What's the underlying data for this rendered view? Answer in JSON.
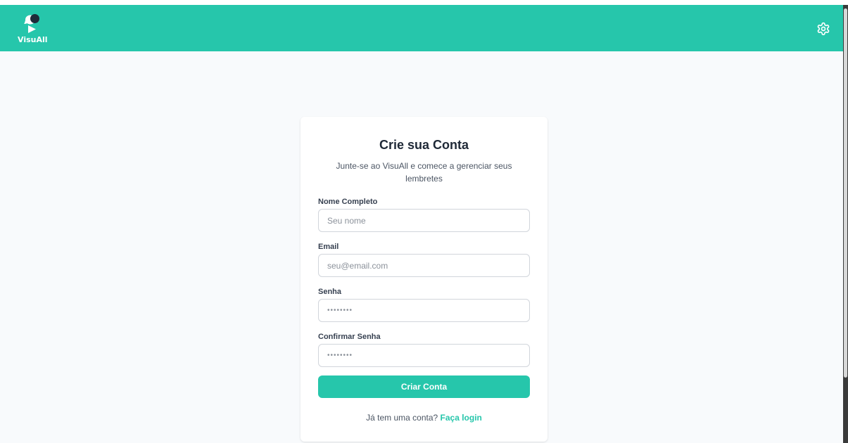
{
  "app": {
    "logo_text": "VisuAll",
    "logo_icon": "chat-play-icon",
    "settings_icon": "gear-icon"
  },
  "colors": {
    "brand": "#26c6ab",
    "background": "#f8fafc",
    "card": "#ffffff",
    "title": "#1f2937"
  },
  "signup": {
    "title": "Crie sua Conta",
    "subtitle": "Junte-se ao VisuAll e comece a gerenciar seus lembretes",
    "fields": [
      {
        "label": "Nome Completo",
        "placeholder": "Seu nome",
        "value": "",
        "type": "text"
      },
      {
        "label": "Email",
        "placeholder": "seu@email.com",
        "value": "",
        "type": "email"
      },
      {
        "label": "Senha",
        "placeholder": "••••••••",
        "value": "",
        "type": "password"
      },
      {
        "label": "Confirmar Senha",
        "placeholder": "••••••••",
        "value": "",
        "type": "password"
      }
    ],
    "submit_label": "Criar Conta",
    "login_prompt": "Já tem uma conta?",
    "login_link": "Faça login"
  }
}
